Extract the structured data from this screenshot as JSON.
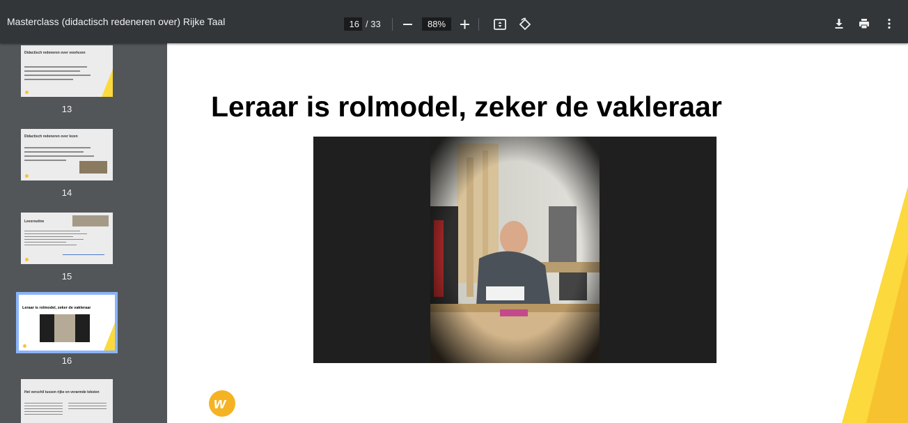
{
  "toolbar": {
    "title": "Masterclass (didactisch redeneren over) Rijke Taal",
    "current_page": "16",
    "total_pages": "/ 33",
    "zoom": "88%",
    "zoom_out_icon": "minus-icon",
    "zoom_in_icon": "plus-icon",
    "fit_icon": "fit-to-page-icon",
    "rotate_icon": "rotate-icon",
    "download_icon": "download-icon",
    "print_icon": "print-icon",
    "menu_icon": "more-vert-icon",
    "colors": {
      "bar": "#323639",
      "sidebar": "#525659",
      "selection": "#8ab4f8",
      "accent": "#fcd93d"
    }
  },
  "sidebar": {
    "thumbnails": [
      {
        "page": "13",
        "title": "Didactisch redeneren over voorlezen"
      },
      {
        "page": "14",
        "title": "Didactisch redeneren over lezen"
      },
      {
        "page": "15",
        "title": "Leesroutine"
      },
      {
        "page": "16",
        "title": "Leraar is rolmodel, zeker de vakleraar",
        "selected": true
      },
      {
        "page": "",
        "title": "Het verschil tussen rijke en verarmde teksten"
      }
    ]
  },
  "slide": {
    "title": "Leraar is rolmodel, zeker de vakleraar",
    "image_description": "man-reading-at-workbench",
    "logo_icon": "brand-logo-icon"
  }
}
